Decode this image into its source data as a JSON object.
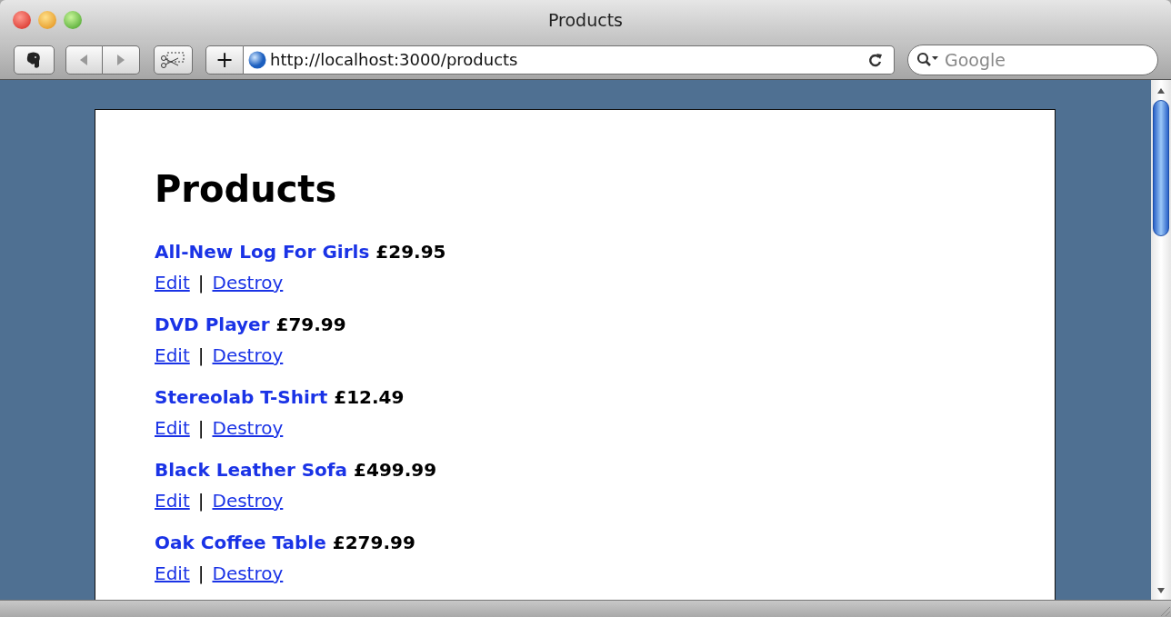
{
  "window": {
    "title": "Products"
  },
  "toolbar": {
    "new_tab": "+",
    "url": "http://localhost:3000/products",
    "search": {
      "placeholder": "Google"
    }
  },
  "page": {
    "heading": "Products",
    "products": [
      {
        "name": "All-New Log For Girls",
        "price": "£29.95",
        "edit": "Edit",
        "separator": "|",
        "destroy": "Destroy"
      },
      {
        "name": "DVD Player",
        "price": "£79.99",
        "edit": "Edit",
        "separator": "|",
        "destroy": "Destroy"
      },
      {
        "name": "Stereolab T-Shirt",
        "price": "£12.49",
        "edit": "Edit",
        "separator": "|",
        "destroy": "Destroy"
      },
      {
        "name": "Black Leather Sofa",
        "price": "£499.99",
        "edit": "Edit",
        "separator": "|",
        "destroy": "Destroy"
      },
      {
        "name": "Oak Coffee Table",
        "price": "£279.99",
        "edit": "Edit",
        "separator": "|",
        "destroy": "Destroy"
      }
    ]
  }
}
